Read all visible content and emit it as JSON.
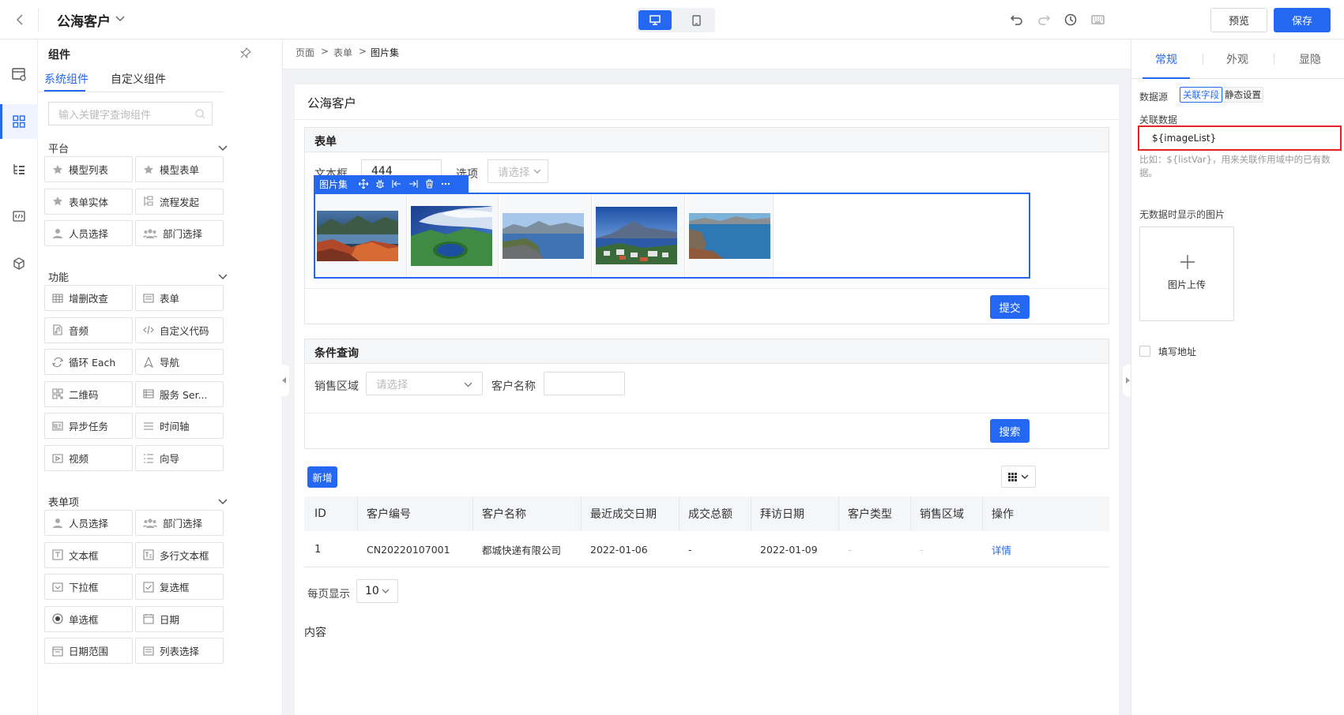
{
  "header": {
    "title": "公海客户",
    "preview_label": "预览",
    "save_label": "保存"
  },
  "panel": {
    "title": "组件",
    "tabs": [
      "系统组件",
      "自定义组件"
    ],
    "search_placeholder": "输入关键字查询组件",
    "sections": [
      {
        "title": "平台",
        "items": [
          {
            "label": "模型列表",
            "icon": "star-icon"
          },
          {
            "label": "模型表单",
            "icon": "star-icon"
          },
          {
            "label": "表单实体",
            "icon": "star-icon"
          },
          {
            "label": "流程发起",
            "icon": "flow-icon"
          },
          {
            "label": "人员选择",
            "icon": "user-icon"
          },
          {
            "label": "部门选择",
            "icon": "group-icon"
          }
        ]
      },
      {
        "title": "功能",
        "items": [
          {
            "label": "增删改查",
            "icon": "table-icon"
          },
          {
            "label": "表单",
            "icon": "form-icon"
          },
          {
            "label": "音频",
            "icon": "audio-icon"
          },
          {
            "label": "自定义代码",
            "icon": "code-icon"
          },
          {
            "label": "循环 Each",
            "icon": "loop-icon"
          },
          {
            "label": "导航",
            "icon": "nav-icon"
          },
          {
            "label": "二维码",
            "icon": "qrcode-icon"
          },
          {
            "label": "服务 Ser...",
            "icon": "service-icon"
          },
          {
            "label": "异步任务",
            "icon": "task-icon"
          },
          {
            "label": "时间轴",
            "icon": "timeline-icon"
          },
          {
            "label": "视频",
            "icon": "video-icon"
          },
          {
            "label": "向导",
            "icon": "wizard-icon"
          }
        ]
      },
      {
        "title": "表单项",
        "items": [
          {
            "label": "人员选择",
            "icon": "user-icon"
          },
          {
            "label": "部门选择",
            "icon": "group-icon"
          },
          {
            "label": "文本框",
            "icon": "textbox-icon"
          },
          {
            "label": "多行文本框",
            "icon": "textarea-icon"
          },
          {
            "label": "下拉框",
            "icon": "select-icon"
          },
          {
            "label": "复选框",
            "icon": "checkbox-icon"
          },
          {
            "label": "单选框",
            "icon": "radio-icon"
          },
          {
            "label": "日期",
            "icon": "date-icon"
          },
          {
            "label": "日期范围",
            "icon": "daterange-icon"
          },
          {
            "label": "列表选择",
            "icon": "listselect-icon"
          }
        ]
      }
    ]
  },
  "breadcrumb": [
    "页面",
    "表单",
    "图片集"
  ],
  "page": {
    "title": "公海客户",
    "form": {
      "title": "表单",
      "text_label": "文本框",
      "text_value": "444",
      "option_label": "选项",
      "option_placeholder": "请选择",
      "toolbar_label": "图片集",
      "submit_label": "提交",
      "images": [
        "lake-autumn-rocks",
        "crater-lake-clouds",
        "lake-rocky-shore",
        "coastal-town-mountain",
        "bay-cliffs"
      ]
    },
    "query": {
      "title": "条件查询",
      "region_label": "销售区域",
      "region_placeholder": "请选择",
      "customer_label": "客户名称",
      "search_label": "搜索"
    },
    "add_label": "新增",
    "table": {
      "columns": [
        "ID",
        "客户编号",
        "客户名称",
        "最近成交日期",
        "成交总额",
        "拜访日期",
        "客户类型",
        "销售区域",
        "操作"
      ],
      "rows": [
        [
          "1",
          "CN20220107001",
          "都城快递有限公司",
          "2022-01-06",
          "-",
          "2022-01-09",
          "-",
          "-",
          "详情"
        ]
      ]
    },
    "page_size_label": "每页显示",
    "page_size_value": "10",
    "content_label": "内容"
  },
  "props": {
    "tabs": [
      "常规",
      "外观",
      "显隐"
    ],
    "datasource_label": "数据源",
    "datasource_options": [
      "关联字段",
      "静态设置"
    ],
    "related_data_label": "关联数据",
    "related_data_value": "${imageList}",
    "hint": "比如：${listVar}，用来关联作用域中的已有数据。",
    "empty_image_label": "无数据时显示的图片",
    "upload_label": "图片上传",
    "fill_url_label": "填写地址"
  },
  "colors": {
    "primary": "#2468f2",
    "highlight_border": "#e52222"
  }
}
